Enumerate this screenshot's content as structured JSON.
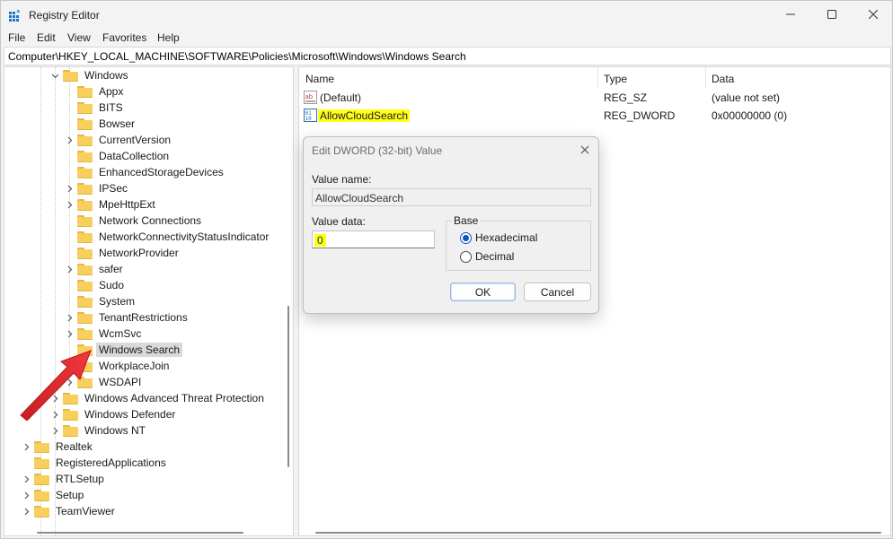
{
  "window": {
    "title": "Registry Editor"
  },
  "menu": [
    "File",
    "Edit",
    "View",
    "Favorites",
    "Help"
  ],
  "address": "Computer\\HKEY_LOCAL_MACHINE\\SOFTWARE\\Policies\\Microsoft\\Windows\\Windows Search",
  "tree": [
    {
      "label": "Windows",
      "level": 2,
      "expander": "expanded"
    },
    {
      "label": "Appx",
      "level": 3,
      "expander": "none"
    },
    {
      "label": "BITS",
      "level": 3,
      "expander": "none"
    },
    {
      "label": "Bowser",
      "level": 3,
      "expander": "none"
    },
    {
      "label": "CurrentVersion",
      "level": 3,
      "expander": "collapsed"
    },
    {
      "label": "DataCollection",
      "level": 3,
      "expander": "none"
    },
    {
      "label": "EnhancedStorageDevices",
      "level": 3,
      "expander": "none"
    },
    {
      "label": "IPSec",
      "level": 3,
      "expander": "collapsed"
    },
    {
      "label": "MpeHttpExt",
      "level": 3,
      "expander": "collapsed"
    },
    {
      "label": "Network Connections",
      "level": 3,
      "expander": "none"
    },
    {
      "label": "NetworkConnectivityStatusIndicator",
      "level": 3,
      "expander": "none"
    },
    {
      "label": "NetworkProvider",
      "level": 3,
      "expander": "none"
    },
    {
      "label": "safer",
      "level": 3,
      "expander": "collapsed"
    },
    {
      "label": "Sudo",
      "level": 3,
      "expander": "none"
    },
    {
      "label": "System",
      "level": 3,
      "expander": "none"
    },
    {
      "label": "TenantRestrictions",
      "level": 3,
      "expander": "collapsed"
    },
    {
      "label": "WcmSvc",
      "level": 3,
      "expander": "collapsed"
    },
    {
      "label": "Windows Search",
      "level": 3,
      "expander": "none",
      "selected": true
    },
    {
      "label": "WorkplaceJoin",
      "level": 3,
      "expander": "none"
    },
    {
      "label": "WSDAPI",
      "level": 3,
      "expander": "collapsed"
    },
    {
      "label": "Windows Advanced Threat Protection",
      "level": 2,
      "expander": "collapsed"
    },
    {
      "label": "Windows Defender",
      "level": 2,
      "expander": "collapsed"
    },
    {
      "label": "Windows NT",
      "level": 2,
      "expander": "collapsed"
    },
    {
      "label": "Realtek",
      "level": 0,
      "expander": "collapsed"
    },
    {
      "label": "RegisteredApplications",
      "level": 0,
      "expander": "none"
    },
    {
      "label": "RTLSetup",
      "level": 0,
      "expander": "collapsed"
    },
    {
      "label": "Setup",
      "level": 0,
      "expander": "collapsed"
    },
    {
      "label": "TeamViewer",
      "level": 0,
      "expander": "collapsed"
    }
  ],
  "list": {
    "columns": {
      "name": "Name",
      "type": "Type",
      "data": "Data"
    },
    "rows": [
      {
        "name": "(Default)",
        "type": "REG_SZ",
        "data": "(value not set)",
        "icon": "string-value-icon",
        "highlight": false
      },
      {
        "name": "AllowCloudSearch",
        "type": "REG_DWORD",
        "data": "0x00000000 (0)",
        "icon": "dword-value-icon",
        "highlight": true
      }
    ]
  },
  "dialog": {
    "title": "Edit DWORD (32-bit) Value",
    "value_name_label": "Value name:",
    "value_name": "AllowCloudSearch",
    "value_data_label": "Value data:",
    "value_data": "0",
    "base_label": "Base",
    "base_options": [
      {
        "label": "Hexadecimal",
        "checked": true
      },
      {
        "label": "Decimal",
        "checked": false
      }
    ],
    "ok_label": "OK",
    "cancel_label": "Cancel"
  },
  "colors": {
    "highlight": "#ffff1a",
    "arrow": "#e5252a",
    "folder": "#f8cf5c",
    "selection": "#d9d9d9",
    "radio_accent": "#0b57c1"
  }
}
